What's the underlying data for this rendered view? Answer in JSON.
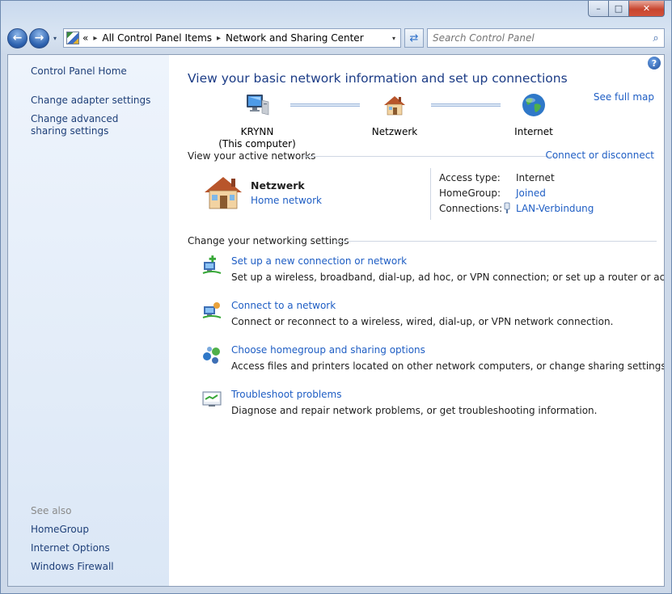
{
  "window": {
    "faint_title": "",
    "caption": {
      "minimize": "–",
      "maximize": "□",
      "close": "✕"
    }
  },
  "nav": {
    "back_icon": "←",
    "forward_icon": "→",
    "history_icon": "▾",
    "overflow": "«",
    "breadcrumbs": [
      "All Control Panel Items",
      "Network and Sharing Center"
    ],
    "separator": "▸",
    "dropdown_icon": "▾",
    "refresh_icon": "⇄",
    "search_placeholder": "Search Control Panel",
    "search_icon": "⌕"
  },
  "sidebar": {
    "home": "Control Panel Home",
    "links": [
      "Change adapter settings",
      "Change advanced sharing settings"
    ],
    "see_also_label": "See also",
    "see_also": [
      "HomeGroup",
      "Internet Options",
      "Windows Firewall"
    ]
  },
  "main": {
    "help_icon": "?",
    "title": "View your basic network information and set up connections",
    "see_full_map": "See full map",
    "map": {
      "computer": {
        "name": "KRYNN",
        "sub": "(This computer)"
      },
      "network": {
        "name": "Netzwerk"
      },
      "internet": {
        "name": "Internet"
      }
    },
    "active_networks": {
      "heading": "View your active networks",
      "connect_link": "Connect or disconnect",
      "name": "Netzwerk",
      "type": "Home network",
      "access_type_label": "Access type:",
      "access_type_value": "Internet",
      "homegroup_label": "HomeGroup:",
      "homegroup_value": "Joined",
      "connections_label": "Connections:",
      "connections_value": "LAN-Verbindung"
    },
    "settings": {
      "heading": "Change your networking settings",
      "tasks": [
        {
          "title": "Set up a new connection or network",
          "desc": "Set up a wireless, broadband, dial-up, ad hoc, or VPN connection; or set up a router or access point."
        },
        {
          "title": "Connect to a network",
          "desc": "Connect or reconnect to a wireless, wired, dial-up, or VPN network connection."
        },
        {
          "title": "Choose homegroup and sharing options",
          "desc": "Access files and printers located on other network computers, or change sharing settings."
        },
        {
          "title": "Troubleshoot problems",
          "desc": "Diagnose and repair network problems, or get troubleshooting information."
        }
      ]
    }
  },
  "colors": {
    "link": "#1f5ec4",
    "title": "#1c3c86",
    "sidebar_link": "#1e3f78"
  }
}
